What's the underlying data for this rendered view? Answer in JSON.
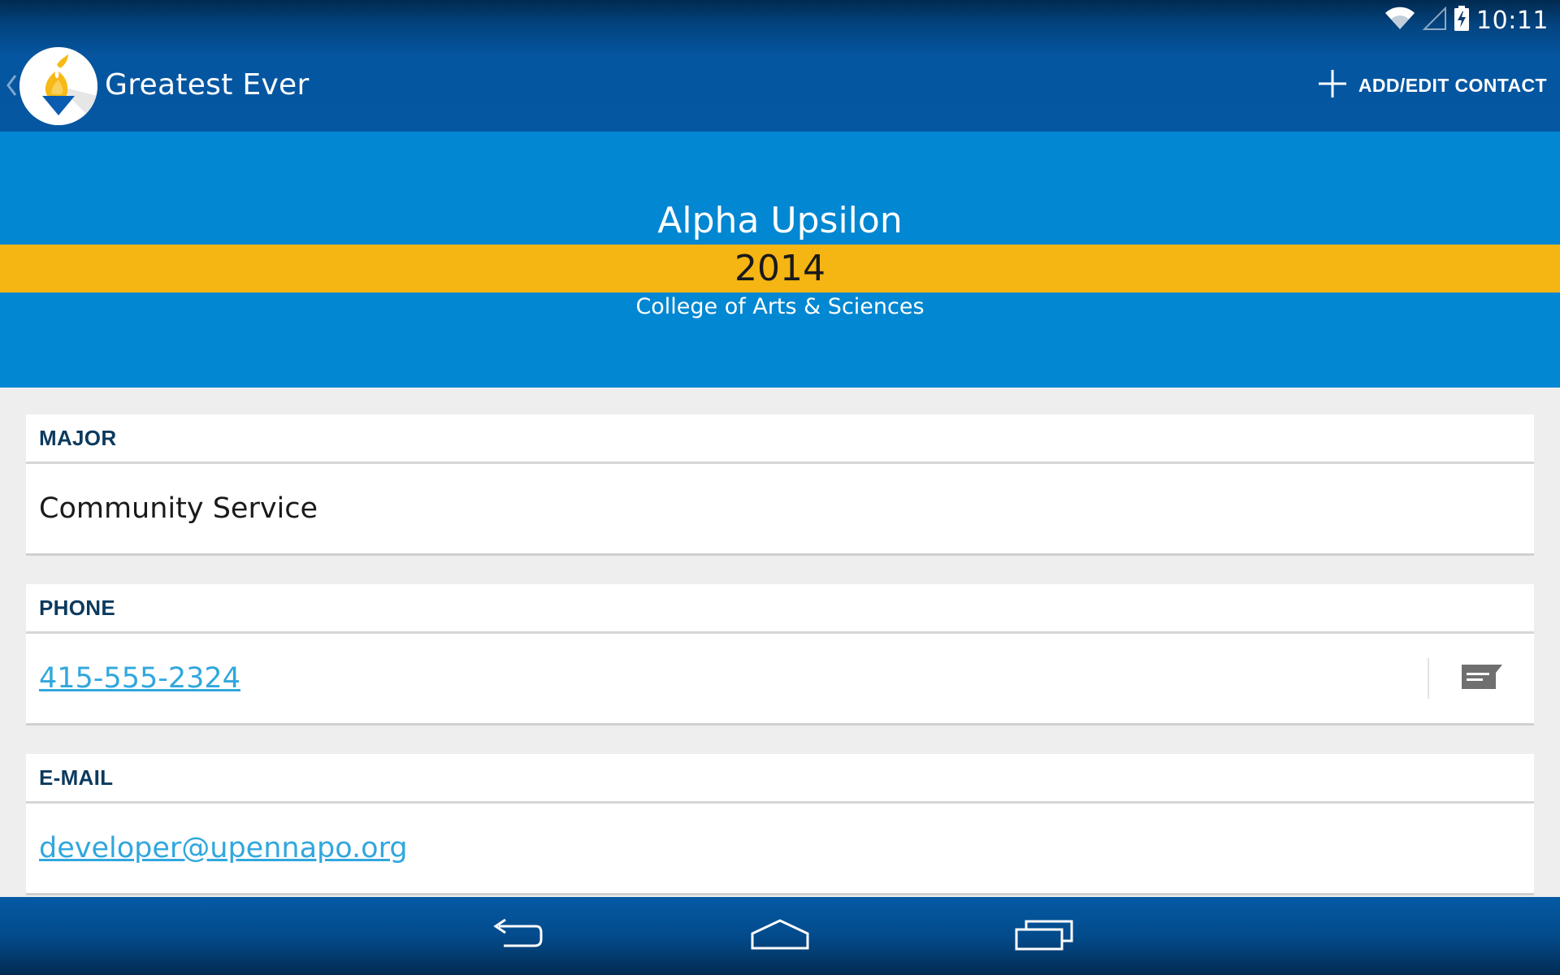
{
  "status_bar": {
    "time": "10:11",
    "icons": [
      "wifi-icon",
      "cell-signal-icon",
      "battery-charging-icon"
    ]
  },
  "action_bar": {
    "title": "Greatest Ever",
    "logo_icon": "torch-logo-icon",
    "add_edit_label": "ADD/EDIT CONTACT"
  },
  "profile": {
    "name": "Alpha Upsilon",
    "year": "2014",
    "school": "College of Arts & Sciences"
  },
  "sections": {
    "major": {
      "label": "MAJOR",
      "value": "Community Service"
    },
    "phone": {
      "label": "PHONE",
      "value": "415-555-2324",
      "action_icon": "sms-message-icon"
    },
    "email": {
      "label": "E-MAIL",
      "value": "developer@upennapo.org"
    }
  },
  "nav_bar": {
    "buttons": [
      "back-icon",
      "home-icon",
      "recent-apps-icon"
    ]
  },
  "colors": {
    "action_bar": "#0557a2",
    "banner": "#0287d2",
    "stripe": "#f5b512",
    "link": "#31a7dd",
    "section_label": "#0c3a5e"
  }
}
